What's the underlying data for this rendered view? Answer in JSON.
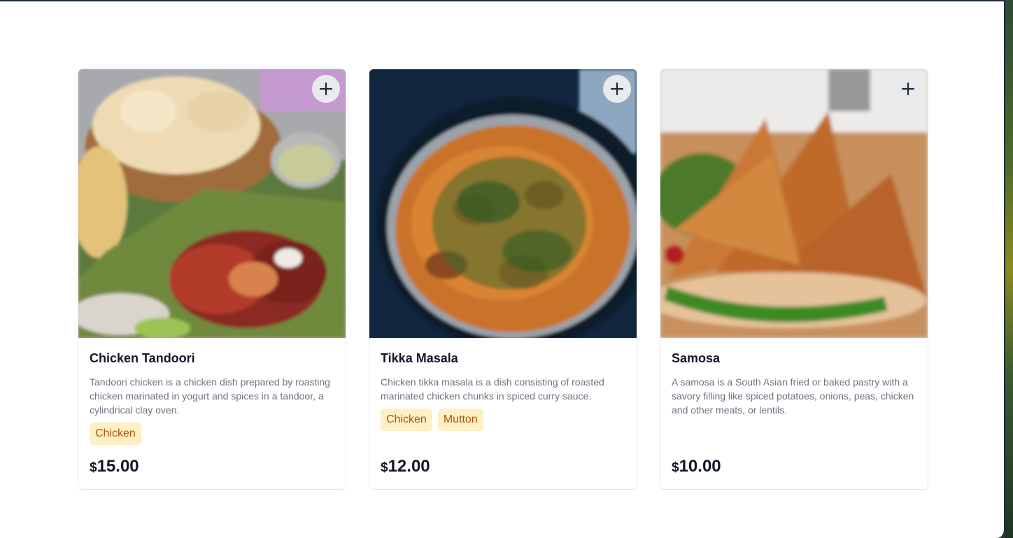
{
  "products": [
    {
      "name": "Chicken Tandoori",
      "description": "Tandoori chicken is a chicken dish prepared by roasting chicken marinated in yogurt and spices in a tandoor, a cylindrical clay oven.",
      "tags": [
        "Chicken"
      ],
      "currency": "$",
      "price": "15.00",
      "image_icon": "chicken-tandoori-photo"
    },
    {
      "name": "Tikka Masala",
      "description": "Chicken tikka masala is a dish consisting of roasted marinated chicken chunks in spiced curry sauce.",
      "tags": [
        "Chicken",
        "Mutton"
      ],
      "currency": "$",
      "price": "12.00",
      "image_icon": "tikka-masala-photo"
    },
    {
      "name": "Samosa",
      "description": "A samosa is a South Asian fried or baked pastry with a savory filling like spiced potatoes, onions, peas, chicken and other meats, or lentils.",
      "tags": [],
      "currency": "$",
      "price": "10.00",
      "image_icon": "samosa-photo"
    }
  ],
  "add_button_icon": "plus-icon",
  "colors": {
    "tag_bg": "#fdf0c4",
    "tag_text": "#b45309",
    "title": "#111827",
    "description": "#6b7280"
  }
}
